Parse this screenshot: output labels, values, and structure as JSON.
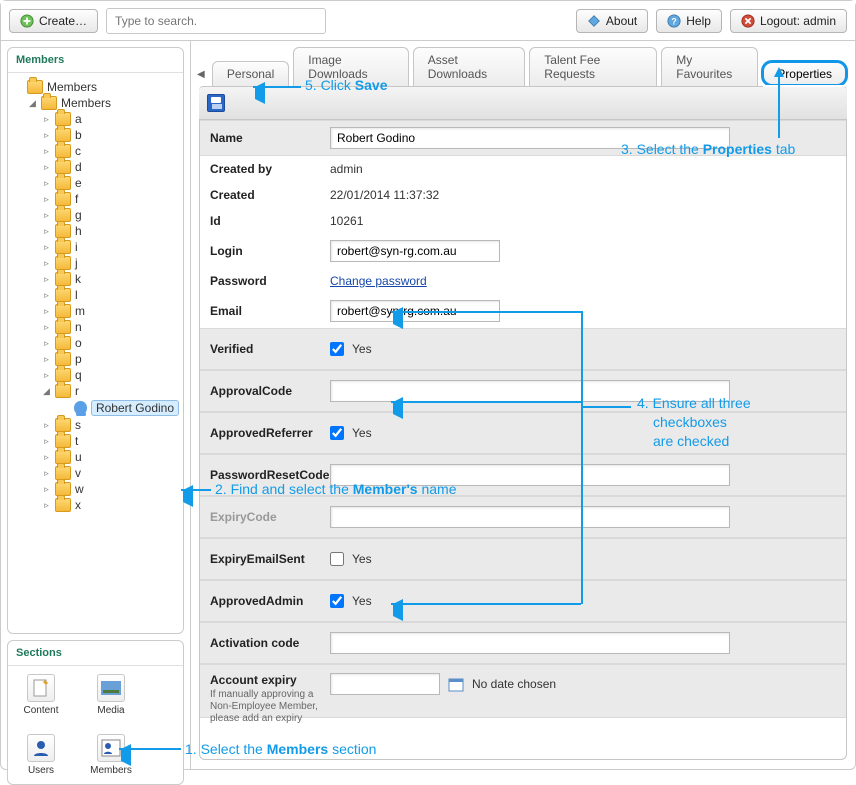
{
  "toolbar": {
    "create": "Create…",
    "search_placeholder": "Type to search.",
    "about": "About",
    "help": "Help",
    "logout": "Logout: admin"
  },
  "left": {
    "members_header": "Members",
    "root": "Members",
    "sub": "Members",
    "letters": [
      "a",
      "b",
      "c",
      "d",
      "e",
      "f",
      "g",
      "h",
      "i",
      "j",
      "k",
      "l",
      "m",
      "n",
      "o",
      "p",
      "q",
      "r",
      "s",
      "t",
      "u",
      "v",
      "w",
      "x"
    ],
    "selected_member": "Robert Godino",
    "sections_header": "Sections",
    "sections": {
      "content": "Content",
      "media": "Media",
      "users": "Users",
      "members": "Members"
    }
  },
  "tabs": {
    "personal": "Personal",
    "image_downloads": "Image Downloads",
    "asset_downloads": "Asset Downloads",
    "talent_fee": "Talent Fee Requests",
    "my_fav": "My Favourites",
    "properties": "Properties"
  },
  "form": {
    "name_label": "Name",
    "name_value": "Robert Godino",
    "createdby_label": "Created by",
    "createdby_value": "admin",
    "created_label": "Created",
    "created_value": "22/01/2014 11:37:32",
    "id_label": "Id",
    "id_value": "10261",
    "login_label": "Login",
    "login_value": "robert@syn-rg.com.au",
    "password_label": "Password",
    "password_link": "Change password",
    "email_label": "Email",
    "email_value": "robert@syn-rg.com.au",
    "verified_label": "Verified",
    "yes": "Yes",
    "approvalcode_label": "ApprovalCode",
    "approvedreferrer_label": "ApprovedReferrer",
    "passwordresetcode_label": "PasswordResetCode",
    "expirycode_label": "ExpiryCode",
    "expiryemailsent_label": "ExpiryEmailSent",
    "approvedadmin_label": "ApprovedAdmin",
    "activationcode_label": "Activation code",
    "accountexpiry_label": "Account expiry",
    "accountexpiry_sub": "If manually approving a Non-Employee Member, please add an expiry",
    "no_date": "No date chosen"
  },
  "annotations": {
    "step1": "1. Select the <b>Members</b> section",
    "step2": "2. Find and select the <b>Member's</b> name",
    "step3": "3. Select the <b>Properties</b> tab",
    "step4line1": "4. Ensure all three",
    "step4line2": "checkboxes",
    "step4line3": "are checked",
    "step5": "5. Click <b>Save</b>"
  }
}
